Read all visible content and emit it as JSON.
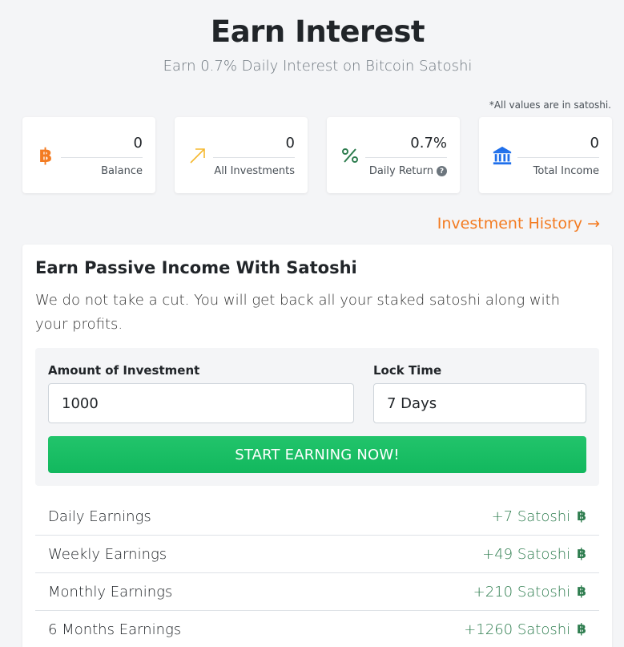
{
  "header": {
    "title": "Earn Interest",
    "subtitle": "Earn 0.7% Daily Interest on Bitcoin Satoshi",
    "note": "*All values are in satoshi."
  },
  "stats": [
    {
      "value": "0",
      "label": "Balance",
      "icon": "bitcoin-icon",
      "color": "#f37b21"
    },
    {
      "value": "0",
      "label": "All Investments",
      "icon": "arrow-up-right-icon",
      "color": "#f5b82e"
    },
    {
      "value": "0.7%",
      "label": "Daily Return",
      "icon": "percent-icon",
      "color": "#2e7d4f"
    },
    {
      "value": "0",
      "label": "Total Income",
      "icon": "bank-icon",
      "color": "#1f6feb"
    }
  ],
  "history_link": "Investment History →",
  "card": {
    "title": "Earn Passive Income With Satoshi",
    "description": "We do not take a cut. You will get back all your staked satoshi along with your profits.",
    "amount_label": "Amount of Investment",
    "amount_value": "1000",
    "lock_label": "Lock Time",
    "lock_value": "7 Days",
    "button_label": "START EARNING NOW!"
  },
  "earnings": [
    {
      "label": "Daily Earnings",
      "value": "+7 Satoshi"
    },
    {
      "label": "Weekly Earnings",
      "value": "+49 Satoshi"
    },
    {
      "label": "Monthly Earnings",
      "value": "+210 Satoshi"
    },
    {
      "label": "6 Months Earnings",
      "value": "+1260 Satoshi"
    }
  ],
  "btc_symbol": "฿"
}
